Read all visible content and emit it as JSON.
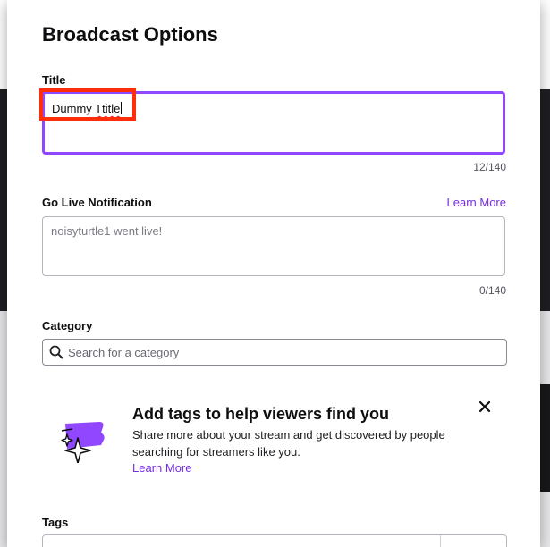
{
  "modal": {
    "title": "Broadcast Options"
  },
  "title_field": {
    "label": "Title",
    "value_word1": "Dummy",
    "value_word2": "Ttitle",
    "counter": "12/140"
  },
  "notification_field": {
    "label": "Go Live Notification",
    "learn_more": "Learn More",
    "placeholder": "noisyturtle1 went live!",
    "counter": "0/140"
  },
  "category_field": {
    "label": "Category",
    "placeholder": "Search for a category"
  },
  "tags_promo": {
    "heading": "Add tags to help viewers find you",
    "body": "Share more about your stream and get discovered by people searching for streamers like you.",
    "learn_more": "Learn More"
  },
  "tags_field": {
    "label": "Tags"
  },
  "colors": {
    "accent": "#9147ff",
    "link": "#772ce8",
    "highlight": "#ff2d0a"
  },
  "icons": {
    "search": "search-icon",
    "close": "close-icon",
    "tags_illustration": "tags-sparkle-icon"
  }
}
